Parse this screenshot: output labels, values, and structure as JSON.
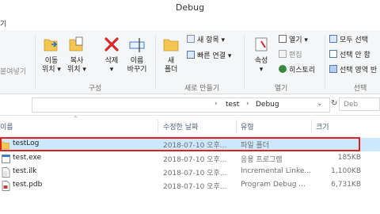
{
  "window": {
    "title": "Debug"
  },
  "tabs": {
    "fragment": "기"
  },
  "ribbon": {
    "partial_left_label": "붙여넣기",
    "organize": {
      "move_to": [
        "이동",
        "위치 ▾"
      ],
      "copy_to": [
        "복사",
        "위치 ▾"
      ],
      "delete": [
        "삭제",
        "▾"
      ],
      "rename": [
        "이름",
        "바꾸기"
      ],
      "label": "구성"
    },
    "new": {
      "new_folder": [
        "새",
        "폴더"
      ],
      "new_item": "새 항목 ▾",
      "easy_access": "빠른 연결 ▾",
      "label": "새로 만들기"
    },
    "open": {
      "properties": [
        "속성",
        "▾"
      ],
      "open": "열기 ▾",
      "edit": "편집",
      "history": "히스토리",
      "label": "열기"
    },
    "select": {
      "select_all": "모두 선택",
      "select_none": "선택 안 함",
      "invert": "선택 영역 반",
      "label": "선택"
    }
  },
  "address": {
    "breadcrumb": [
      "test",
      "Debug"
    ],
    "search_placeholder": "Deb"
  },
  "columns": {
    "name": "이름",
    "date": "수정한 날짜",
    "type": "유형",
    "size": "크기"
  },
  "files": [
    {
      "name": "testLog",
      "date": "2018-07-10 오후...",
      "type": "파일 폴더",
      "size": "",
      "icon": "folder-icon",
      "selected": true
    },
    {
      "name": "test.exe",
      "date": "2018-07-10 오후...",
      "type": "응용 프로그램",
      "size": "185KB",
      "icon": "exe-icon",
      "selected": false
    },
    {
      "name": "test.ilk",
      "date": "2018-07-10 오후...",
      "type": "Incremental Linke...",
      "size": "1,100KB",
      "icon": "ilk-file-icon",
      "selected": false
    },
    {
      "name": "test.pdb",
      "date": "2018-07-10 오후...",
      "type": "Program Debug ...",
      "size": "6,731KB",
      "icon": "pdb-file-icon",
      "selected": false
    }
  ],
  "colors": {
    "highlight_border": "#e0201f",
    "selection_bg": "#cce8ff",
    "folder": "#f4c650"
  }
}
